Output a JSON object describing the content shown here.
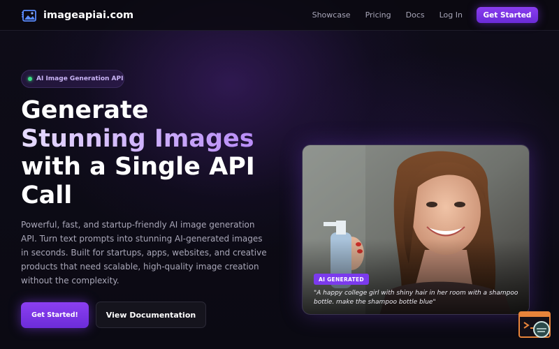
{
  "brand": {
    "name": "imageapiai.com"
  },
  "nav": {
    "links": [
      "Showcase",
      "Pricing",
      "Docs",
      "Log In"
    ],
    "cta": "Get Started"
  },
  "hero": {
    "badge": "AI Image Generation API",
    "title_line1": "Generate",
    "title_accent": "Stunning Images",
    "title_line3": "with a Single API",
    "title_line4": "Call",
    "description": "Powerful, fast, and startup-friendly AI image generation API. Turn text prompts into stunning AI-generated images in seconds. Built for startups, apps, websites, and creative products that need scalable, high-quality image creation without the complexity.",
    "primary_button": "Get Started!",
    "secondary_button": "View Documentation"
  },
  "showcase_card": {
    "badge": "AI GENERATED",
    "prompt": "\"A happy college girl with shiny hair in her room with a shampoo bottle. make the shampoo bottle blue\""
  },
  "colors": {
    "accent": "#7b3aed",
    "background": "#0b0a12",
    "badge_dot": "#3ddc84"
  },
  "icons": [
    "logo-icon",
    "status-dot-icon",
    "chat-widget-icon"
  ]
}
